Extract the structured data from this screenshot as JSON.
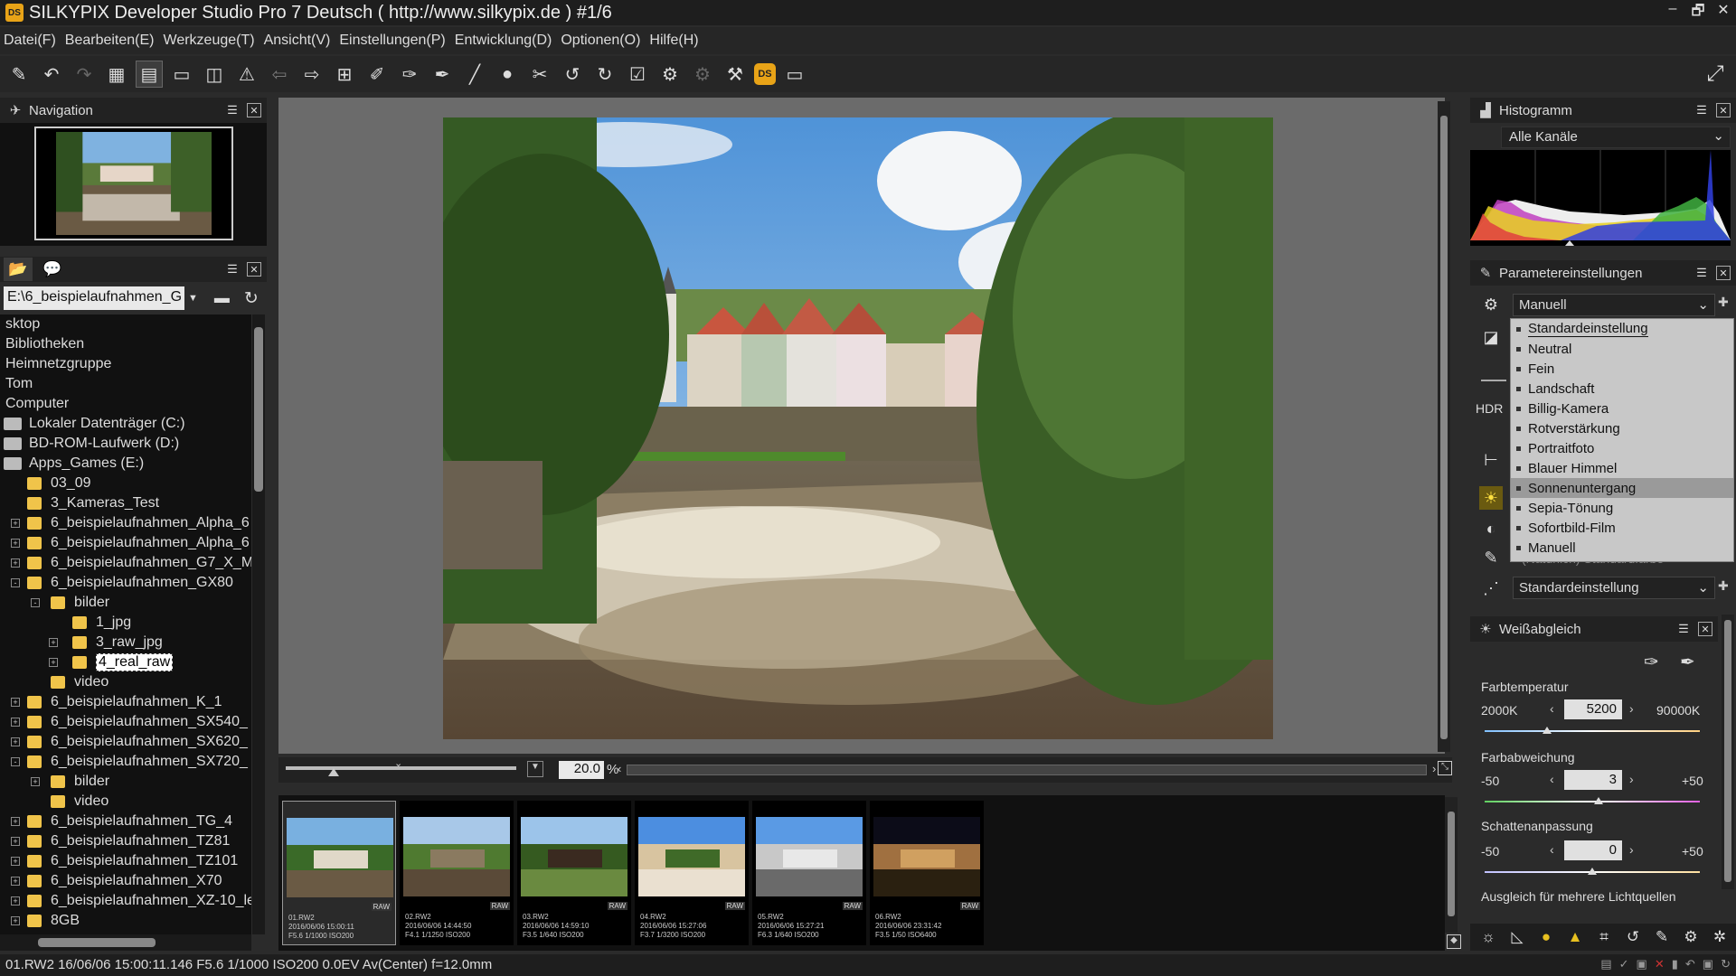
{
  "window": {
    "title": "SILKYPIX Developer Studio Pro 7 Deutsch ( http://www.silkypix.de )   #1/6",
    "app_icon": "DS",
    "controls": [
      "–",
      "🗗",
      "✕"
    ]
  },
  "menu": [
    "Datei(F)",
    "Bearbeiten(E)",
    "Werkzeuge(T)",
    "Ansicht(V)",
    "Einstellungen(P)",
    "Entwicklung(D)",
    "Optionen(O)",
    "Hilfe(H)"
  ],
  "toolbar_icons": [
    "develop-icon",
    "undo-icon",
    "redo-icon",
    "grid-view-icon",
    "filmstrip-view-icon",
    "single-view-icon",
    "compare-view-icon",
    "warning-icon",
    "prev-icon",
    "next-icon",
    "crop-icon",
    "pipette-gray-icon",
    "pipette-wb-icon",
    "pipette-skin-icon",
    "brush-icon",
    "spot-icon",
    "straighten-icon",
    "rotate-left-icon",
    "rotate-right-icon",
    "mark-icon",
    "batch-develop-icon",
    "batch-settings-icon",
    "hammer-icon",
    "ds-icon",
    "monitor-icon"
  ],
  "navigation": {
    "title": "Navigation"
  },
  "folder": {
    "path": "E:\\6_beispielaufnahmen_G",
    "tree": [
      {
        "label": "sktop",
        "level": 0,
        "kind": "none"
      },
      {
        "label": "Bibliotheken",
        "level": 0,
        "kind": "none"
      },
      {
        "label": "Heimnetzgruppe",
        "level": 0,
        "kind": "none"
      },
      {
        "label": "Tom",
        "level": 0,
        "kind": "none"
      },
      {
        "label": "Computer",
        "level": 0,
        "kind": "none"
      },
      {
        "label": "Lokaler Datenträger (C:)",
        "level": 0,
        "kind": "drive"
      },
      {
        "label": "BD-ROM-Laufwerk (D:)",
        "level": 0,
        "kind": "drive"
      },
      {
        "label": "Apps_Games (E:)",
        "level": 0,
        "kind": "drive"
      },
      {
        "label": "03_09",
        "level": 1,
        "kind": "folder"
      },
      {
        "label": "3_Kameras_Test",
        "level": 1,
        "kind": "folder"
      },
      {
        "label": "6_beispielaufnahmen_Alpha_6",
        "level": 1,
        "kind": "folder",
        "exp": "+"
      },
      {
        "label": "6_beispielaufnahmen_Alpha_6",
        "level": 1,
        "kind": "folder",
        "exp": "+"
      },
      {
        "label": "6_beispielaufnahmen_G7_X_M",
        "level": 1,
        "kind": "folder",
        "exp": "+"
      },
      {
        "label": "6_beispielaufnahmen_GX80",
        "level": 1,
        "kind": "folder",
        "exp": "-"
      },
      {
        "label": "bilder",
        "level": 2,
        "kind": "folder",
        "exp": "-"
      },
      {
        "label": "1_jpg",
        "level": 3,
        "kind": "folder"
      },
      {
        "label": "3_raw_jpg",
        "level": 3,
        "kind": "folder",
        "exp": "+"
      },
      {
        "label": "4_real_raw",
        "level": 3,
        "kind": "folder",
        "exp": "+",
        "selected": true
      },
      {
        "label": "video",
        "level": 2,
        "kind": "folder"
      },
      {
        "label": "6_beispielaufnahmen_K_1",
        "level": 1,
        "kind": "folder",
        "exp": "+"
      },
      {
        "label": "6_beispielaufnahmen_SX540_",
        "level": 1,
        "kind": "folder",
        "exp": "+"
      },
      {
        "label": "6_beispielaufnahmen_SX620_",
        "level": 1,
        "kind": "folder",
        "exp": "+"
      },
      {
        "label": "6_beispielaufnahmen_SX720_",
        "level": 1,
        "kind": "folder",
        "exp": "-"
      },
      {
        "label": "bilder",
        "level": 2,
        "kind": "folder",
        "exp": "+"
      },
      {
        "label": "video",
        "level": 2,
        "kind": "folder"
      },
      {
        "label": "6_beispielaufnahmen_TG_4",
        "level": 1,
        "kind": "folder",
        "exp": "+"
      },
      {
        "label": "6_beispielaufnahmen_TZ81",
        "level": 1,
        "kind": "folder",
        "exp": "+"
      },
      {
        "label": "6_beispielaufnahmen_TZ101",
        "level": 1,
        "kind": "folder",
        "exp": "+"
      },
      {
        "label": "6_beispielaufnahmen_X70",
        "level": 1,
        "kind": "folder",
        "exp": "+"
      },
      {
        "label": "6_beispielaufnahmen_XZ-10_le",
        "level": 1,
        "kind": "folder",
        "exp": "+"
      },
      {
        "label": "8GB",
        "level": 1,
        "kind": "folder",
        "exp": "+"
      }
    ]
  },
  "viewer": {
    "zoom": "20.0",
    "zoom_unit": "%"
  },
  "filmstrip": [
    {
      "name": "01.RW2",
      "date": "2016/06/06 15:00:11",
      "exif": "F5.6 1/1000 ISO200",
      "raw": "RAW",
      "scene": "river"
    },
    {
      "name": "02.RW2",
      "date": "2016/06/06 14:44:50",
      "exif": "F4.1 1/1250 ISO200",
      "raw": "RAW",
      "scene": "bridge"
    },
    {
      "name": "03.RW2",
      "date": "2016/06/06 14:59:10",
      "exif": "F3.5 1/640 ISO200",
      "raw": "RAW",
      "scene": "pavilion"
    },
    {
      "name": "04.RW2",
      "date": "2016/06/06 15:27:06",
      "exif": "F3.7 1/3200 ISO200",
      "raw": "RAW",
      "scene": "town"
    },
    {
      "name": "05.RW2",
      "date": "2016/06/06 15:27:21",
      "exif": "F6.3 1/640 ISO200",
      "raw": "RAW",
      "scene": "street"
    },
    {
      "name": "06.RW2",
      "date": "2016/06/06 23:31:42",
      "exif": "F3.5 1/50 ISO6400",
      "raw": "RAW",
      "scene": "night"
    }
  ],
  "histogram": {
    "title": "Histogramm",
    "channel": "Alle Kanäle"
  },
  "parameters": {
    "title": "Parametereinstellungen",
    "preset": "Manuell",
    "hdr": "HDR",
    "natural_partial": "(Natürlich) Standardfarbe",
    "second_preset": "Standardeinstellung",
    "dropdown": [
      {
        "label": "Standardeinstellung",
        "underline": true
      },
      {
        "label": "Neutral"
      },
      {
        "label": "Fein"
      },
      {
        "label": "Landschaft"
      },
      {
        "label": "Billig-Kamera"
      },
      {
        "label": "Rotverstärkung"
      },
      {
        "label": "Portraitfoto"
      },
      {
        "label": "Blauer Himmel"
      },
      {
        "label": "Sonnenuntergang",
        "highlighted": true
      },
      {
        "label": "Sepia-Tönung"
      },
      {
        "label": "Sofortbild-Film"
      },
      {
        "label": "Manuell"
      }
    ]
  },
  "whitebalance": {
    "title": "Weißabgleich",
    "temp_label": "Farbtemperatur",
    "temp_min": "2000K",
    "temp_max": "90000K",
    "temp_value": "5200",
    "dev_label": "Farbabweichung",
    "dev_min": "-50",
    "dev_max": "+50",
    "dev_value": "3",
    "shadow_label": "Schattenanpassung",
    "shadow_min": "-50",
    "shadow_max": "+50",
    "shadow_value": "0",
    "multi_label": "Ausgleich für mehrere Lichtquellen"
  },
  "status": "01.RW2 16/06/06 15:00:11.146 F5.6 1/1000 ISO200  0.0EV Av(Center) f=12.0mm"
}
